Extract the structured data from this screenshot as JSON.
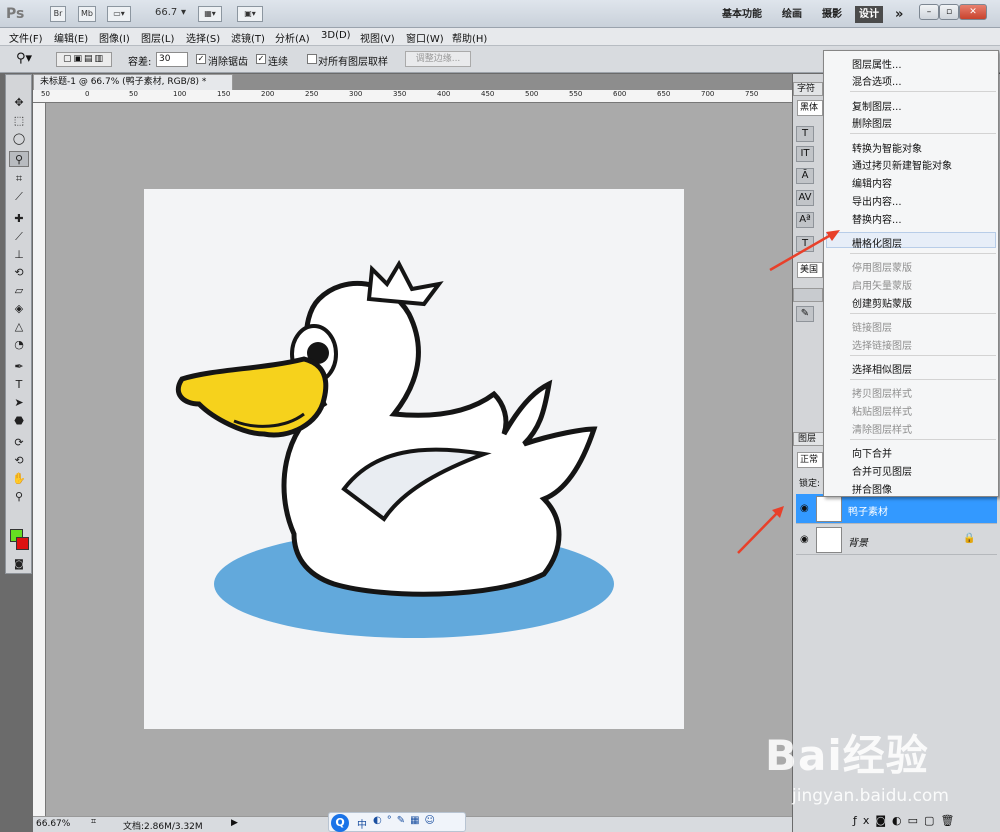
{
  "app": {
    "logo": "Ps",
    "mode_btn_br": "Br",
    "mode_btn_mb": "Mb",
    "zoom_value": "66.7"
  },
  "workspaces": [
    "基本功能",
    "绘画",
    "摄影",
    "设计"
  ],
  "workspace_more": "»",
  "window_controls": {
    "minimize": "–",
    "restore": "▫",
    "close": "✕"
  },
  "menubar": [
    "文件(F)",
    "编辑(E)",
    "图像(I)",
    "图层(L)",
    "选择(S)",
    "滤镜(T)",
    "分析(A)",
    "3D(D)",
    "视图(V)",
    "窗口(W)",
    "帮助(H)"
  ],
  "options": {
    "tolerance_label": "容差:",
    "tolerance_value": "30",
    "antialias_label": "消除锯齿",
    "contiguous_label": "连续",
    "all_layers_label": "对所有图层取样",
    "refine_button": "调整边缘..."
  },
  "document": {
    "tab_title": "未标题-1 @ 66.7% (鸭子素材, RGB/8) *",
    "ruler_labels": [
      "50",
      "0",
      "50",
      "100",
      "150",
      "200",
      "250",
      "300",
      "350",
      "400",
      "450",
      "500",
      "550",
      "600",
      "650",
      "700",
      "750"
    ]
  },
  "status": {
    "zoom": "66.67%",
    "doc_info": "文档:2.86M/3.32M"
  },
  "right_panel": {
    "char_tab": "字符",
    "font_sample": "黑体",
    "lang": "美国",
    "layers_tab": "图层",
    "blend_mode": "正常",
    "lock_label": "锁定:"
  },
  "layers": [
    {
      "name": "鸭子素材",
      "selected": true
    },
    {
      "name": "背景",
      "selected": false
    }
  ],
  "context_menu": [
    {
      "label": "图层属性...",
      "enabled": true
    },
    {
      "label": "混合选项...",
      "enabled": true
    },
    {
      "label": "复制图层...",
      "enabled": true
    },
    {
      "label": "删除图层",
      "enabled": true
    },
    {
      "label": "转换为智能对象",
      "enabled": true
    },
    {
      "label": "通过拷贝新建智能对象",
      "enabled": true
    },
    {
      "label": "编辑内容",
      "enabled": true
    },
    {
      "label": "导出内容...",
      "enabled": true
    },
    {
      "label": "替换内容...",
      "enabled": true
    },
    {
      "label": "栅格化图层",
      "enabled": true,
      "highlighted": true
    },
    {
      "label": "停用图层蒙版",
      "enabled": false
    },
    {
      "label": "启用矢量蒙版",
      "enabled": false
    },
    {
      "label": "创建剪贴蒙版",
      "enabled": true
    },
    {
      "label": "链接图层",
      "enabled": false
    },
    {
      "label": "选择链接图层",
      "enabled": false
    },
    {
      "label": "选择相似图层",
      "enabled": true
    },
    {
      "label": "拷贝图层样式",
      "enabled": false
    },
    {
      "label": "粘贴图层样式",
      "enabled": false
    },
    {
      "label": "清除图层样式",
      "enabled": false
    },
    {
      "label": "向下合并",
      "enabled": true
    },
    {
      "label": "合并可见图层",
      "enabled": true
    },
    {
      "label": "拼合图像",
      "enabled": true
    }
  ],
  "watermark": {
    "logo": "Bai经验",
    "url": "jingyan.baidu.com"
  },
  "taskbar": {
    "ime": "中"
  },
  "colors": {
    "foreground": "#66dd22",
    "background": "#dd1111",
    "layer_selected": "#3399ff",
    "arrow": "#e8402a",
    "duck_water": "#62a9dc",
    "duck_beak": "#f6d21c"
  }
}
